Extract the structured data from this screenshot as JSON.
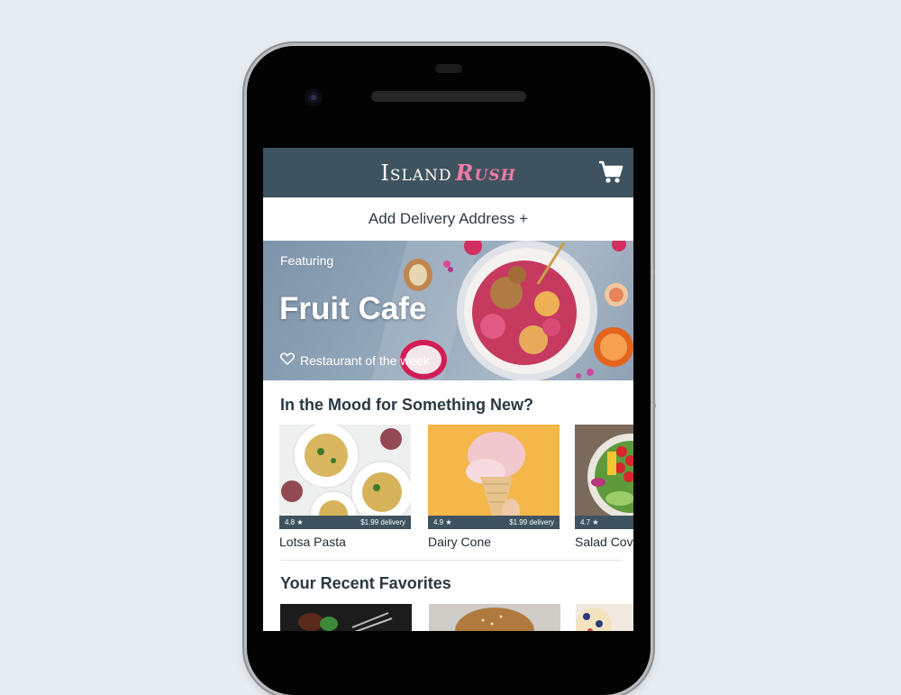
{
  "app": {
    "brand_part1": "Island",
    "brand_part2": "Rush",
    "cart_icon": "cart-icon"
  },
  "address": {
    "label": "Add Delivery Address +"
  },
  "hero": {
    "eyebrow": "Featuring",
    "title": "Fruit Cafe",
    "tagline": "Restaurant of the week",
    "tag_icon": "heart-icon"
  },
  "mood_section": {
    "title": "In the Mood for Something New?",
    "cards": [
      {
        "name": "Lotsa Pasta",
        "rating": "4.8 ★",
        "delivery": "$1.99 delivery"
      },
      {
        "name": "Dairy Cone",
        "rating": "4.9 ★",
        "delivery": "$1.99 delivery"
      },
      {
        "name": "Salad Cove",
        "rating": "4.7 ★",
        "delivery": ""
      }
    ]
  },
  "favorites_section": {
    "title": "Your Recent Favorites"
  },
  "colors": {
    "header": "#3e535f",
    "brand_accent": "#f17aa5",
    "background": "#e6ecf0"
  }
}
